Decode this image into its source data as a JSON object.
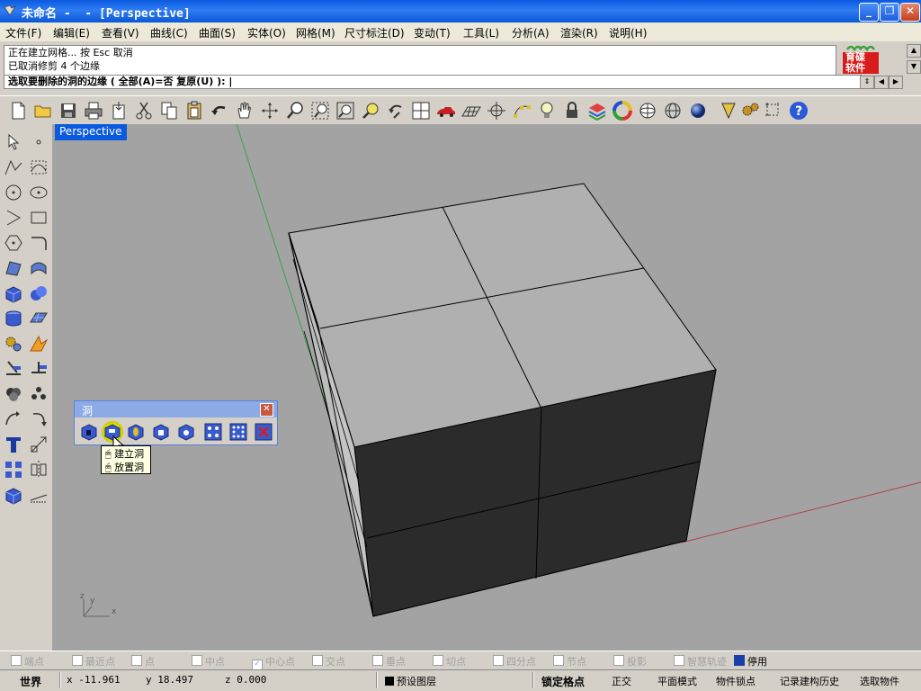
{
  "window": {
    "title": "未命名 -  - [Perspective]",
    "controls": {
      "minimize": "_",
      "maximize": "❐",
      "close": "✕"
    }
  },
  "menu": [
    {
      "label": "文件(F)"
    },
    {
      "label": "编辑(E)"
    },
    {
      "label": "查看(V)"
    },
    {
      "label": "曲线(C)"
    },
    {
      "label": "曲面(S)"
    },
    {
      "label": "实体(O)"
    },
    {
      "label": "网格(M)"
    },
    {
      "label": "尺寸标注(D)"
    },
    {
      "label": "变动(T)"
    },
    {
      "label": "工具(L)"
    },
    {
      "label": "分析(A)"
    },
    {
      "label": "渲染(R)"
    },
    {
      "label": "说明(H)"
    }
  ],
  "command": {
    "history": [
      "正在建立网格... 按 Esc 取消",
      "已取消修剪 4 个边缘"
    ],
    "prompt": "选取要删除的洞的边缘 ( 全部(A)=否  复原(U) ): |"
  },
  "logo": {
    "line1": "育碟",
    "line2": "软件"
  },
  "top_toolbar": [
    {
      "icon": "new-file-icon"
    },
    {
      "icon": "open-folder-icon"
    },
    {
      "icon": "save-icon"
    },
    {
      "icon": "print-icon"
    },
    {
      "icon": "import-icon"
    },
    {
      "icon": "cut-icon"
    },
    {
      "icon": "copy-icon"
    },
    {
      "icon": "paste-icon"
    },
    {
      "icon": "undo-icon"
    },
    {
      "icon": "pan-hand-icon"
    },
    {
      "icon": "rotate-view-icon"
    },
    {
      "icon": "zoom-icon"
    },
    {
      "icon": "zoom-window-icon"
    },
    {
      "icon": "zoom-extents-icon"
    },
    {
      "icon": "zoom-selected-icon"
    },
    {
      "icon": "undo-view-icon"
    },
    {
      "icon": "four-viewports-icon"
    },
    {
      "icon": "car-icon"
    },
    {
      "icon": "grid-plane-icon"
    },
    {
      "icon": "snap-icon"
    },
    {
      "icon": "point-edit-icon"
    },
    {
      "icon": "light-bulb-icon"
    },
    {
      "icon": "lock-icon"
    },
    {
      "icon": "layer-icon"
    },
    {
      "icon": "color-wheel-icon"
    },
    {
      "icon": "shaded-sphere-icon"
    },
    {
      "icon": "wire-sphere-icon"
    },
    {
      "icon": "render-sphere-icon"
    },
    {
      "icon": "render-cone-icon"
    },
    {
      "icon": "settings-gears-icon"
    },
    {
      "icon": "grid-dimension-icon"
    },
    {
      "icon": "help-icon"
    }
  ],
  "left_toolbar": [
    {
      "icon": "select-arrow-icon"
    },
    {
      "icon": "point-icon"
    },
    {
      "icon": "polyline-icon"
    },
    {
      "icon": "curve-icon"
    },
    {
      "icon": "circle-icon"
    },
    {
      "icon": "ellipse-icon"
    },
    {
      "icon": "arc-icon"
    },
    {
      "icon": "rectangle-icon"
    },
    {
      "icon": "polygon-icon"
    },
    {
      "icon": "fillet-curve-icon"
    },
    {
      "icon": "surface-corner-icon"
    },
    {
      "icon": "surface-sweep-icon"
    },
    {
      "icon": "box-solid-icon"
    },
    {
      "icon": "sphere-solid-icon"
    },
    {
      "icon": "cylinder-solid-icon"
    },
    {
      "icon": "mesh-plane-icon"
    },
    {
      "icon": "gears-icon"
    },
    {
      "icon": "explode-icon"
    },
    {
      "icon": "trim-icon"
    },
    {
      "icon": "split-icon"
    },
    {
      "icon": "boolean-union-icon"
    },
    {
      "icon": "group-icon"
    },
    {
      "icon": "move-icon"
    },
    {
      "icon": "rotate-icon"
    },
    {
      "icon": "text-icon"
    },
    {
      "icon": "scale-icon"
    },
    {
      "icon": "array-icon"
    },
    {
      "icon": "mirror-icon"
    },
    {
      "icon": "box-icon"
    },
    {
      "icon": "dimension-icon"
    }
  ],
  "viewport": {
    "label": "Perspective"
  },
  "hole_toolbar": {
    "title": "洞",
    "close": "✕",
    "buttons": [
      {
        "icon": "make-hole-icon"
      },
      {
        "icon": "make-hole-active-icon"
      },
      {
        "icon": "round-hole-icon"
      },
      {
        "icon": "move-hole-icon"
      },
      {
        "icon": "rotate-hole-icon"
      },
      {
        "icon": "array-hole-icon"
      },
      {
        "icon": "array-hole-polar-icon"
      },
      {
        "icon": "delete-hole-icon"
      }
    ],
    "tooltip": [
      "建立洞",
      "放置洞"
    ]
  },
  "osnaps": [
    {
      "label": "端点",
      "checked": false
    },
    {
      "label": "最近点",
      "checked": false
    },
    {
      "label": "点",
      "checked": false
    },
    {
      "label": "中点",
      "checked": false
    },
    {
      "label": "中心点",
      "checked": true
    },
    {
      "label": "交点",
      "checked": false
    },
    {
      "label": "垂点",
      "checked": false
    },
    {
      "label": "切点",
      "checked": false
    },
    {
      "label": "四分点",
      "checked": false
    },
    {
      "label": "节点",
      "checked": false
    },
    {
      "label": "投影",
      "checked": false
    },
    {
      "label": "智慧轨迹",
      "checked": true
    },
    {
      "label": "停用",
      "checked": true,
      "active": true
    }
  ],
  "status": {
    "cplane": "世界",
    "x": "x -11.961",
    "y": "y 18.497",
    "z": "z 0.000",
    "layer": "预设图层",
    "grid_snap": "锁定格点",
    "ortho": "正交",
    "planar": "平面模式",
    "osnap": "物件锁点",
    "history": "记录建构历史",
    "filter": "选取物件"
  },
  "colors": {
    "title_bar": "#0a5ae0",
    "viewport_bg": "#a3a3a3",
    "cube_top": "#b0b0b0",
    "cube_front": "#2b2b2b",
    "cube_left": "#c8c8c8",
    "x_axis": "#b04040",
    "y_axis": "#3fa04a"
  }
}
